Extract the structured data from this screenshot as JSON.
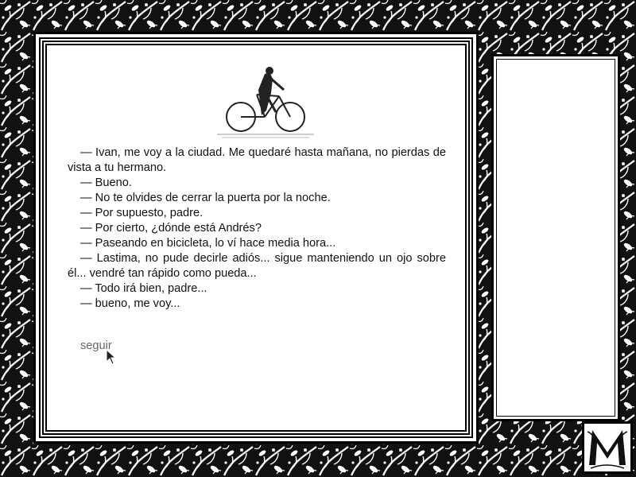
{
  "dialogue": [
    "— Ivan, me voy a la ciudad. Me quedaré hasta mañana, no pierdas de vista a tu hermano.",
    "— Bueno.",
    "— No te olvides de cerrar la puerta por la noche.",
    "— Por supuesto, padre.",
    "— Por cierto, ¿dónde está Andrés?",
    "— Paseando en bicicleta, lo ví hace media hora...",
    "— Lastima, no pude decirle adiós... sigue manteniendo un ojo sobre él... vendré tan rápido como pueda...",
    "— Todo irá bien, padre...",
    "— bueno, me voy..."
  ],
  "continue_label": "seguir",
  "logo_letter": "M",
  "colors": {
    "ornament_dark": "#111111",
    "paper": "#ffffff",
    "link_gray": "#666666"
  },
  "icons": {
    "illustration": "cyclist-icon",
    "cursor": "mouse-pointer-icon",
    "logo": "ornate-m-logo"
  }
}
